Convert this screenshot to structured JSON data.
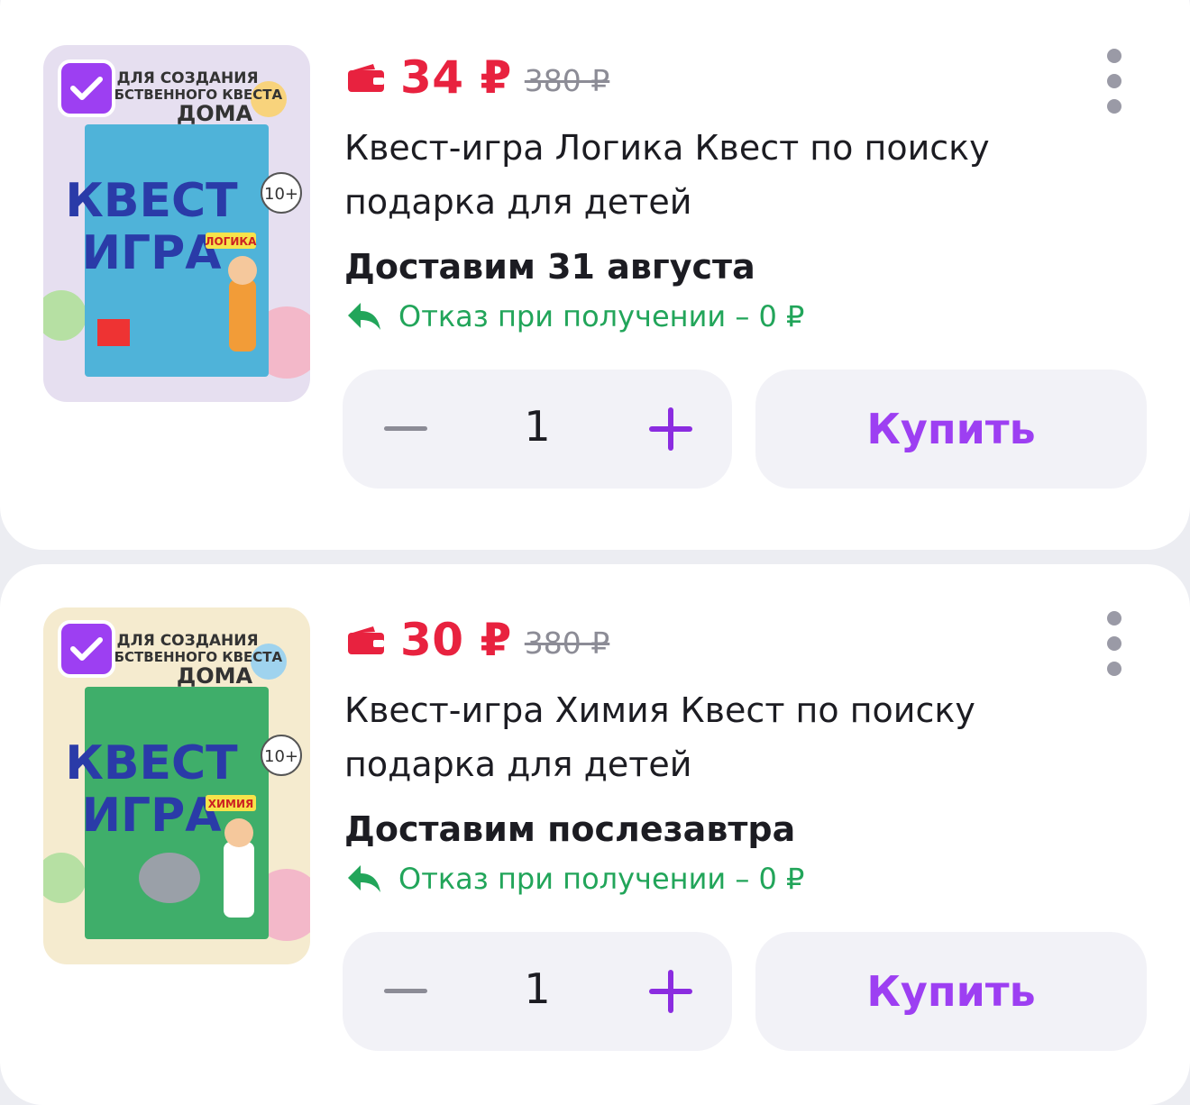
{
  "items": [
    {
      "price": "34 ₽",
      "old_price": "380 ₽",
      "title": "Квест-игра Логика Квест по поиску подарка для детей",
      "delivery": "Доставим 31 августа",
      "refund": "Отказ при получении – 0 ₽",
      "quantity": "1",
      "buy_label": "Купить",
      "cover_subject": "ЛОГИКА",
      "cover_color": "#4fb3d9",
      "bg_color": "#e6dff0"
    },
    {
      "price": "30 ₽",
      "old_price": "380 ₽",
      "title": "Квест-игра Химия Квест по поиску подарка для детей",
      "delivery": "Доставим послезавтра",
      "refund": "Отказ при получении – 0 ₽",
      "quantity": "1",
      "buy_label": "Купить",
      "cover_subject": "ХИМИЯ",
      "cover_color": "#3fae6a",
      "bg_color": "#f5ebcf"
    }
  ],
  "cover": {
    "header_line1": "ДЛЯ СОЗДАНИЯ",
    "header_line2": "СОБСТВЕННОГО КВЕСТА",
    "header_line3": "ДОМА",
    "title_line1": "КВЕСТ",
    "title_line2": "ИГРА",
    "age": "10+"
  },
  "colors": {
    "accent": "#9d3ff2",
    "price": "#e8223f",
    "refund": "#22a55a"
  }
}
